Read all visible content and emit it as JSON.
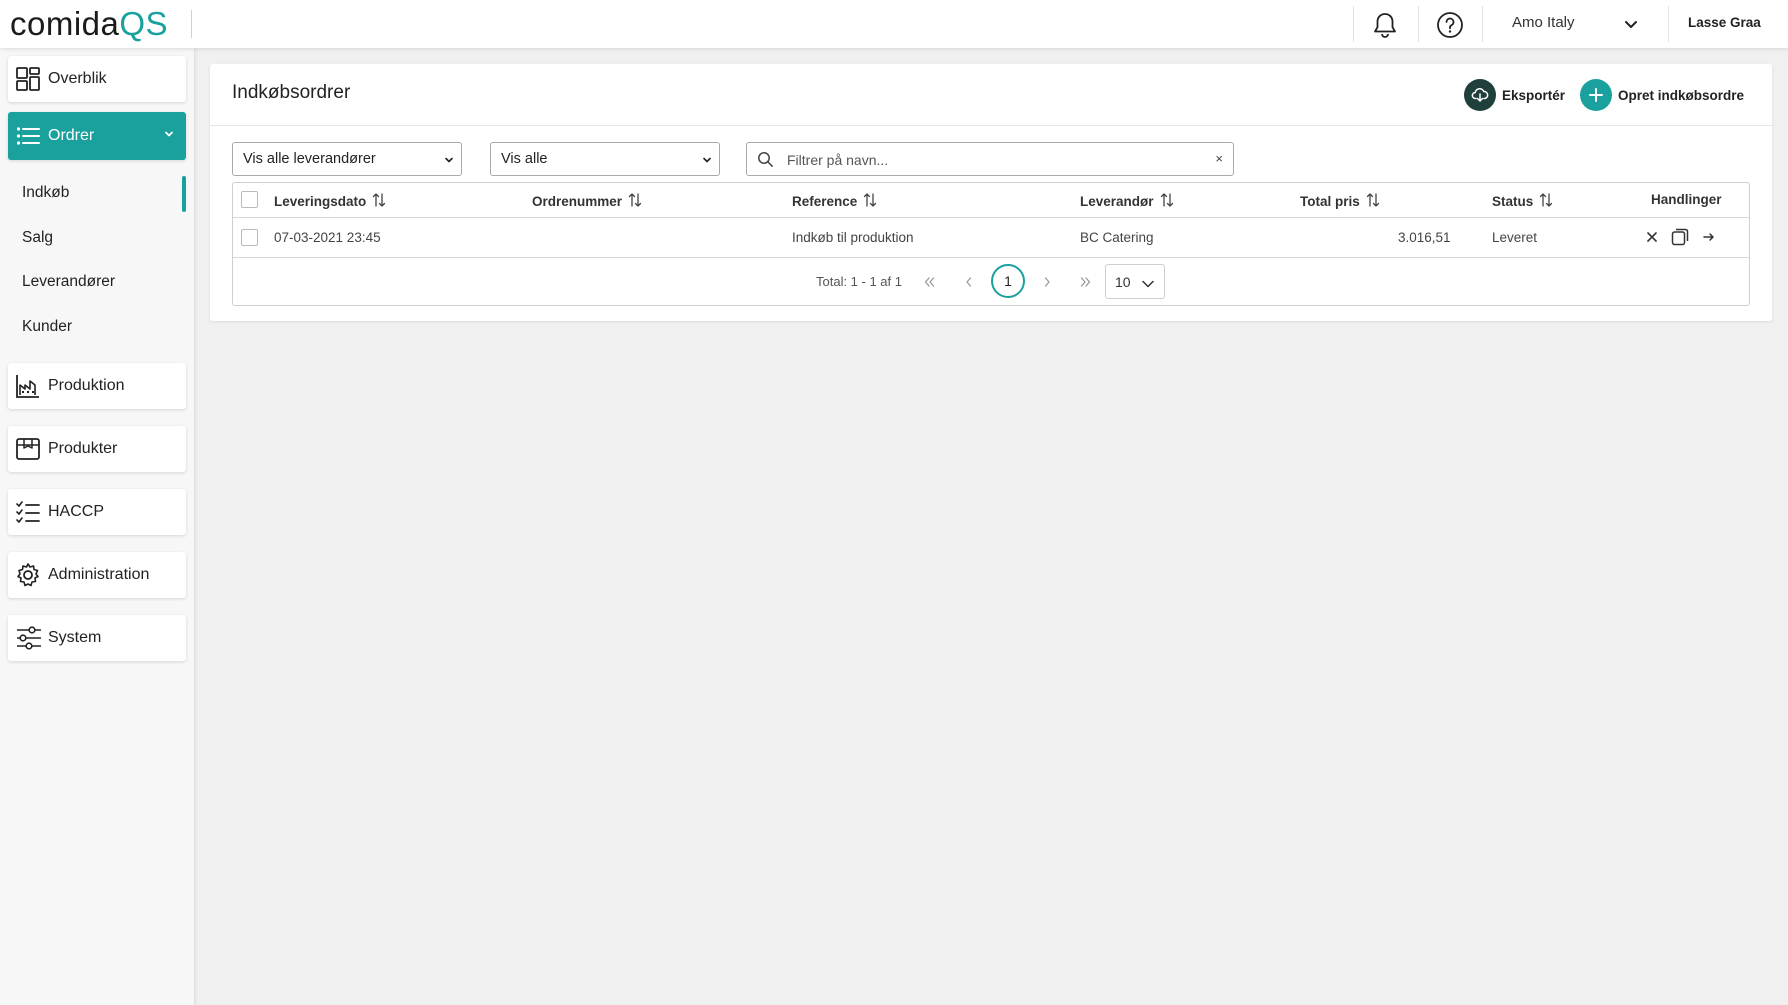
{
  "app": {
    "logo_part1": "comida",
    "logo_part2": "QS",
    "company": "Amo Italy",
    "user": "Lasse Graa"
  },
  "sidebar": {
    "items": [
      {
        "label": "Overblik",
        "icon": "dashboard-icon"
      },
      {
        "label": "Ordrer",
        "icon": "list-icon"
      },
      {
        "label": "Produktion",
        "icon": "factory-icon"
      },
      {
        "label": "Produkter",
        "icon": "box-icon"
      },
      {
        "label": "HACCP",
        "icon": "checklist-icon"
      },
      {
        "label": "Administration",
        "icon": "gear-icon"
      },
      {
        "label": "System",
        "icon": "sliders-icon"
      }
    ],
    "sub_items": [
      {
        "label": "Indkøb"
      },
      {
        "label": "Salg"
      },
      {
        "label": "Leverandører"
      },
      {
        "label": "Kunder"
      }
    ]
  },
  "page": {
    "title": "Indkøbsordrer",
    "export_label": "Eksportér",
    "create_label": "Opret indkøbsordre"
  },
  "filters": {
    "supplier_select": "Vis alle leverandører",
    "status_select": "Vis alle",
    "search_placeholder": "Filtrer på navn...",
    "clear_symbol": "×"
  },
  "table": {
    "columns": [
      "Leveringsdato",
      "Ordrenummer",
      "Reference",
      "Leverandør",
      "Total pris",
      "Status",
      "Handlinger"
    ],
    "rows": [
      {
        "date": "07-03-2021 23:45",
        "order_no": "",
        "reference": "Indkøb til produktion",
        "supplier": "BC Catering",
        "total": "3.016,51",
        "status": "Leveret"
      }
    ]
  },
  "pagination": {
    "total_text": "Total: 1 - 1 af 1",
    "current_page": "1",
    "page_size": "10"
  },
  "colors": {
    "accent": "#1aa19d",
    "dark_button": "#1f3f3d"
  }
}
